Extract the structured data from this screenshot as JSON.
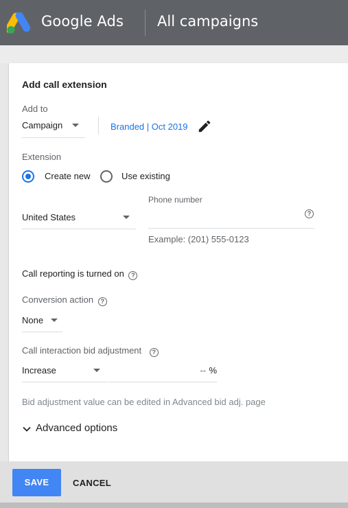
{
  "header": {
    "brand": "Google Ads",
    "section": "All campaigns",
    "logo_colors": [
      "#fbbc04",
      "#4285f4",
      "#34a853"
    ]
  },
  "form": {
    "title": "Add call extension",
    "add_to": {
      "label": "Add to",
      "selected": "Campaign",
      "campaign_link": "Branded | Oct 2019"
    },
    "extension": {
      "label": "Extension",
      "options": [
        {
          "label": "Create new",
          "selected": true
        },
        {
          "label": "Use existing",
          "selected": false
        }
      ]
    },
    "phone": {
      "country": "United States",
      "label": "Phone number",
      "value": "",
      "example": "Example: (201) 555-0123"
    },
    "call_reporting": {
      "text": "Call reporting is turned on"
    },
    "conversion": {
      "label": "Conversion action",
      "selected": "None"
    },
    "bid": {
      "label": "Call interaction bid adjustment",
      "direction": "Increase",
      "value": "--",
      "unit": "%",
      "note": "Bid adjustment value can be edited in Advanced bid adj. page"
    },
    "advanced": {
      "label": "Advanced options"
    }
  },
  "actions": {
    "save": "SAVE",
    "cancel": "CANCEL"
  },
  "colors": {
    "primary": "#4285f4",
    "link": "#1a73e8",
    "header_bg": "#5f6368"
  }
}
